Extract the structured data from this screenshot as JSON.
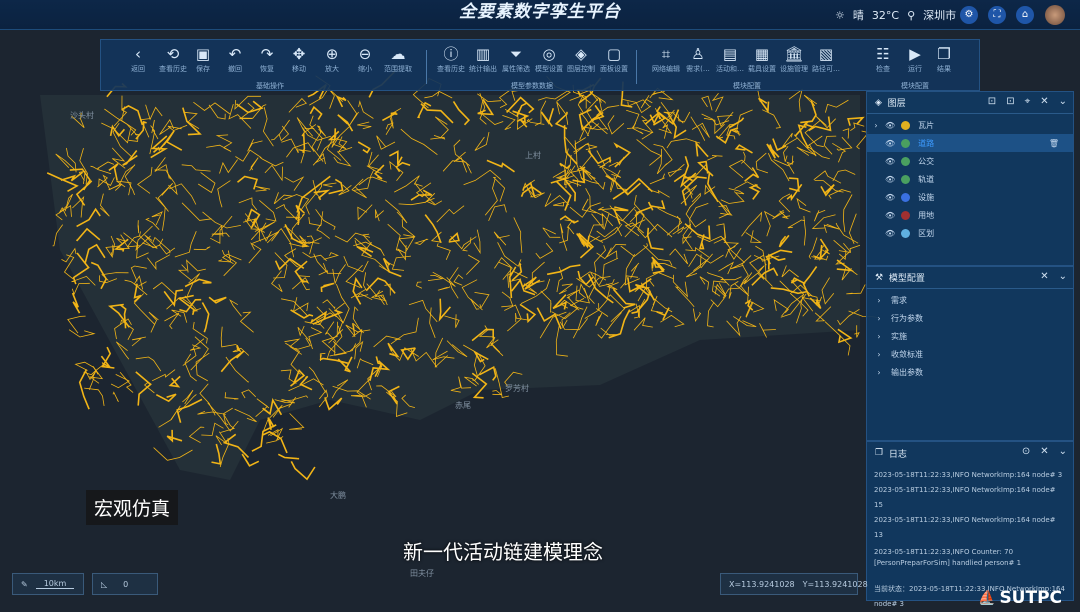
{
  "header": {
    "title": "全要素数字孪生平台",
    "weather": "晴",
    "temperature": "32°C",
    "city": "深圳市"
  },
  "toolbar": {
    "groups": [
      {
        "label": "基础操作"
      },
      {
        "label": "模型参数数据"
      },
      {
        "label": "模块配置"
      },
      {
        "label": "模块配置"
      }
    ],
    "tools": [
      {
        "label": "返回",
        "icon": "‹"
      },
      {
        "label": "查看历史",
        "icon": "⟲"
      },
      {
        "label": "保存",
        "icon": "▣"
      },
      {
        "label": "撤回",
        "icon": "↶"
      },
      {
        "label": "恢复",
        "icon": "↷"
      },
      {
        "label": "移动",
        "icon": "✥"
      },
      {
        "label": "放大",
        "icon": "⊕"
      },
      {
        "label": "缩小",
        "icon": "⊖"
      },
      {
        "label": "范围提取",
        "icon": "☁"
      },
      {
        "label": "查看历史",
        "icon": "ⓘ"
      },
      {
        "label": "统计输出",
        "icon": "▥"
      },
      {
        "label": "属性筛选",
        "icon": "⏷"
      },
      {
        "label": "模型设置",
        "icon": "◎"
      },
      {
        "label": "图层控制",
        "icon": "◈"
      },
      {
        "label": "面板设置",
        "icon": "▢"
      },
      {
        "label": "网络编辑",
        "icon": "⌗"
      },
      {
        "label": "需求(…",
        "icon": "♙"
      },
      {
        "label": "活动和…",
        "icon": "▤"
      },
      {
        "label": "载具设置",
        "icon": "▦"
      },
      {
        "label": "设施管理",
        "icon": "🏛"
      },
      {
        "label": "路径可…",
        "icon": "▧"
      },
      {
        "label": "检查",
        "icon": "☷"
      },
      {
        "label": "运行",
        "icon": "▶"
      },
      {
        "label": "结果",
        "icon": "❐"
      }
    ]
  },
  "layers": {
    "title": "图层",
    "items": [
      {
        "label": "瓦片",
        "color": "#e0b020"
      },
      {
        "label": "道路",
        "color": "#4aa060"
      },
      {
        "label": "公交",
        "color": "#4aa060"
      },
      {
        "label": "轨道",
        "color": "#4aa060"
      },
      {
        "label": "设施",
        "color": "#3a70e0"
      },
      {
        "label": "用地",
        "color": "#a03030"
      },
      {
        "label": "区划",
        "color": "#60b0e0"
      }
    ]
  },
  "model_config": {
    "title": "模型配置",
    "items": [
      "需求",
      "行为参数",
      "实施",
      "收敛标准",
      "输出参数"
    ]
  },
  "log": {
    "title": "日志",
    "entries": [
      "2023-05-18T11:22:33,INFO NetworkImp:164  node# 3",
      "2023-05-18T11:22:33,INFO NetworkImp:164  node# 15",
      "2023-05-18T11:22:33,INFO NetworkImp:164  node# 13",
      "2023-05-18T11:22:33,INFO Counter: 70",
      "[PersonPreparForSim] handlied person# 1"
    ],
    "status": "当前状态：2023-05-18T11:22:33,INFO NetworkImp:164  node# 3"
  },
  "map": {
    "labels": [
      "沙头村",
      "上村",
      "罗芳村",
      "赤尾",
      "大鹏",
      "田夫仔"
    ],
    "scale": "10km",
    "angle": "0",
    "coord_x": "X=113.9241028",
    "coord_y": "Y=113.9241028"
  },
  "subtitles": {
    "left": "宏观仿真",
    "center": "新一代活动链建模理念"
  },
  "brand": "SUTPC",
  "colors": {
    "road": "#f2b517",
    "accent": "#3d9bff"
  }
}
